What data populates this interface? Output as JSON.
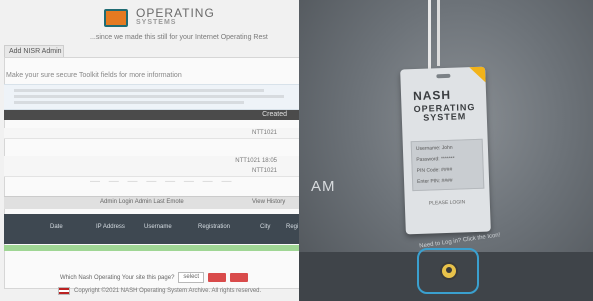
{
  "site": {
    "logo_title": "OPERATING",
    "logo_subtitle": "SYSTEMS",
    "tagline": "...since we made this still for your Internet Operating Rest",
    "tab_label": "Add NISR Admin",
    "info_note": "Make your sure secure Toolkit fields for more information",
    "table_header_label": "Created",
    "rows": [
      "NTT1021",
      "NTT1021 18:05",
      "NTT1021"
    ],
    "ghost_text": "— — — — — — — —",
    "filter_left": "Admin Login Admin Last Emote",
    "filter_right": "View History",
    "columns": [
      "Date",
      "IP Address",
      "Username",
      "Registration",
      "City",
      "Regi"
    ],
    "footer_question": "Which Nash Operating Your site this page?",
    "footer_select": "select",
    "copyright": "Copyright ©2021 NASH Operating System Archive. All rights reserved."
  },
  "hero": {
    "badge_title": "NASH",
    "badge_subtitle": "OPERATING SYSTEM",
    "badge_fields": [
      "Username: John",
      "Password: *******",
      "PIN Code: ####",
      "Enter PIN: ####"
    ],
    "badge_login": "PLEASE LOGIN",
    "side_text": "AM",
    "caption": "Need to Log in? Click the Icon!"
  },
  "colors": {
    "accent_orange": "#e57a21",
    "accent_teal": "#1f6b73",
    "badge_corner": "#f2b31a",
    "highlight_ring": "#3aa0cf",
    "success_bar": "#9fd694",
    "danger_button": "#d94b4b"
  },
  "icons": {
    "logo": "logo-icon",
    "flag": "flag-icon",
    "user": "user-icon"
  }
}
